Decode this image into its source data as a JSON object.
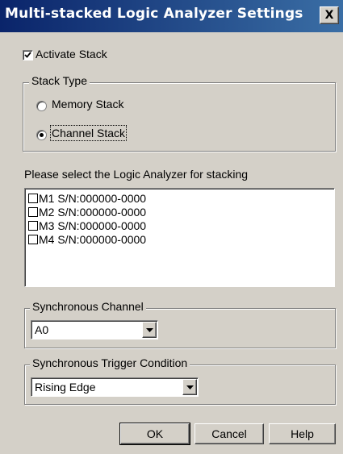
{
  "window": {
    "title": "Multi-stacked Logic Analyzer Settings",
    "close_label": "X"
  },
  "activate_stack": {
    "label": "Activate Stack",
    "checked": true
  },
  "stack_type": {
    "legend": "Stack Type",
    "options": [
      {
        "label": "Memory Stack",
        "selected": false
      },
      {
        "label": "Channel Stack",
        "selected": true
      }
    ]
  },
  "analyzer_select": {
    "prompt": "Please select the Logic Analyzer for stacking",
    "items": [
      {
        "label": "M1 S/N:000000-0000",
        "checked": false
      },
      {
        "label": "M2 S/N:000000-0000",
        "checked": false
      },
      {
        "label": "M3 S/N:000000-0000",
        "checked": false
      },
      {
        "label": "M4 S/N:000000-0000",
        "checked": false
      }
    ]
  },
  "sync_channel": {
    "legend": "Synchronous Channel",
    "value": "A0"
  },
  "sync_trigger": {
    "legend": "Synchronous Trigger Condition",
    "value": "Rising Edge"
  },
  "buttons": {
    "ok": "OK",
    "cancel": "Cancel",
    "help": "Help"
  },
  "colors": {
    "title_bar": "#0a246a",
    "face": "#d4d0c8"
  }
}
